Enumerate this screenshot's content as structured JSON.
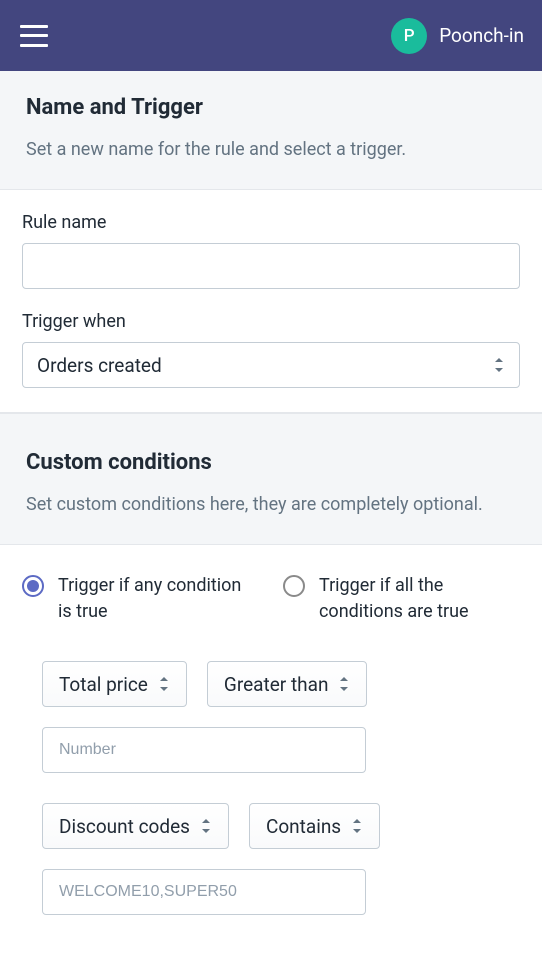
{
  "header": {
    "avatar_initial": "P",
    "username": "Poonch-in"
  },
  "section1": {
    "title": "Name and Trigger",
    "desc": "Set a new name for the rule and select a trigger.",
    "rule_name_label": "Rule name",
    "rule_name_value": "",
    "trigger_label": "Trigger when",
    "trigger_value": "Orders created"
  },
  "section2": {
    "title": "Custom conditions",
    "desc": "Set custom conditions here, they are completely optional.",
    "radio_any": "Trigger if any condition is true",
    "radio_all": "Trigger if all the conditions are true",
    "conditions": [
      {
        "field": "Total price",
        "operator": "Greater than",
        "placeholder": "Number",
        "value": ""
      },
      {
        "field": "Discount codes",
        "operator": "Contains",
        "placeholder": "WELCOME10,SUPER50",
        "value": ""
      }
    ]
  }
}
